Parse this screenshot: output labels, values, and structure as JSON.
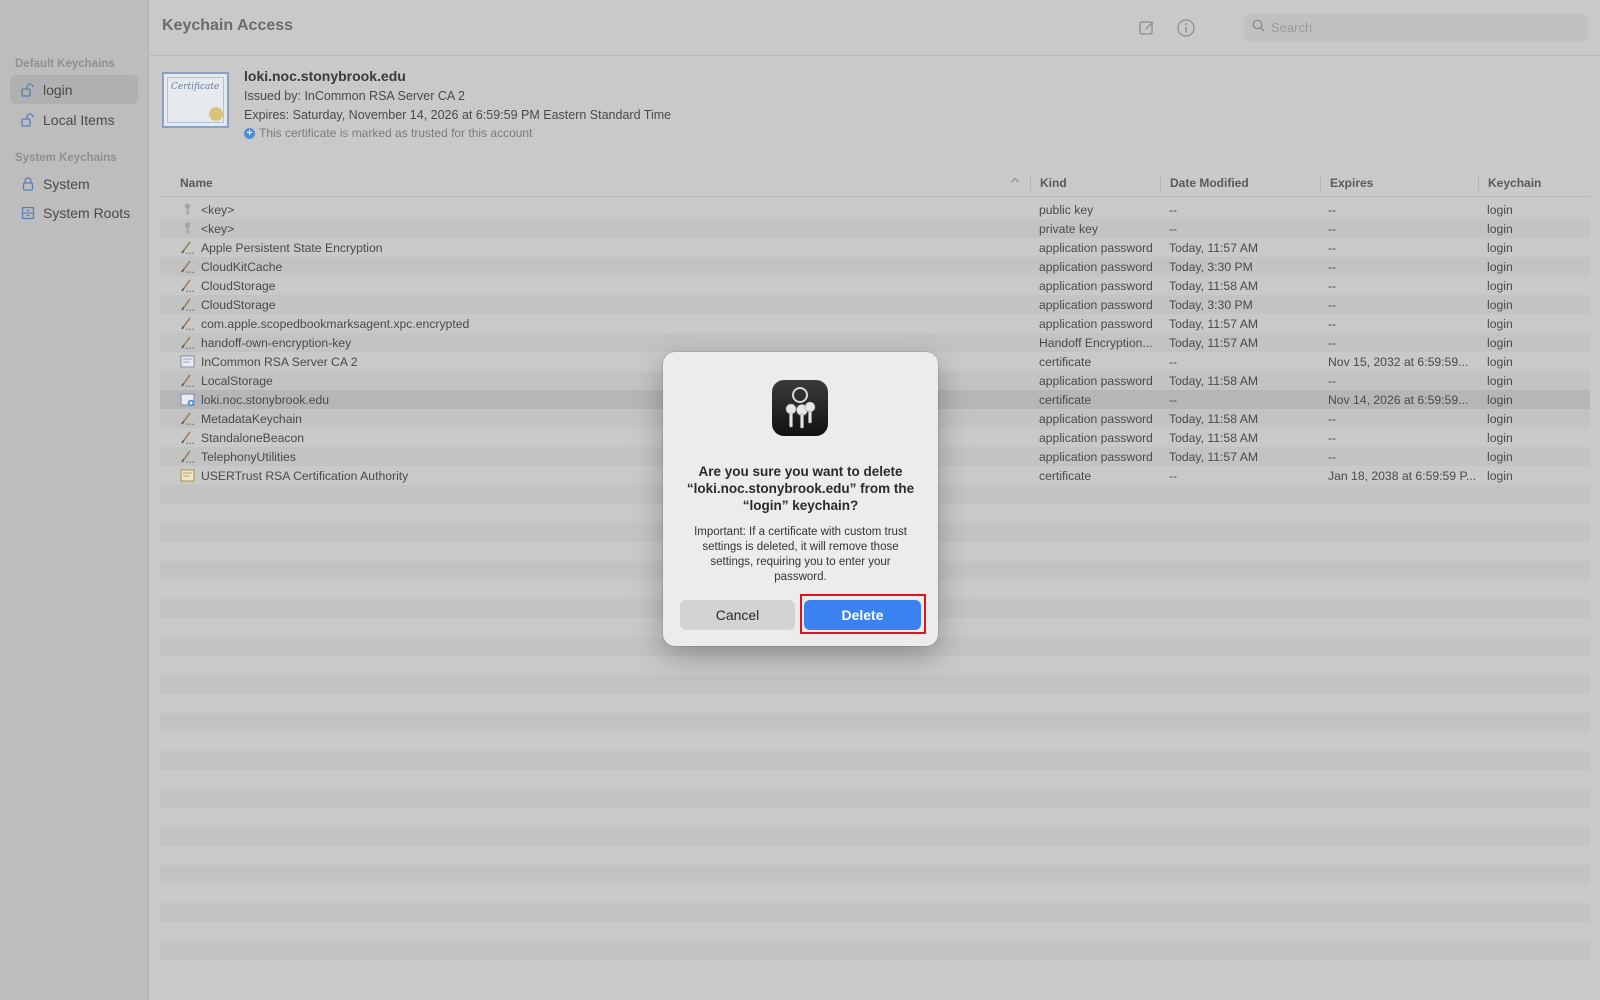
{
  "window": {
    "title": "Keychain Access"
  },
  "search": {
    "placeholder": "Search"
  },
  "sidebar": {
    "default_title": "Default Keychains",
    "system_title": "System Keychains",
    "items": [
      {
        "label": "login",
        "icon": "unlocked-padlock-icon",
        "selected": true
      },
      {
        "label": "Local Items",
        "icon": "unlocked-padlock-icon",
        "selected": false
      },
      {
        "label": "System",
        "icon": "locked-padlock-icon",
        "selected": false
      },
      {
        "label": "System Roots",
        "icon": "cabinet-icon",
        "selected": false
      }
    ]
  },
  "header": {
    "name": "loki.noc.stonybrook.edu",
    "issued_by": "Issued by: InCommon RSA Server CA 2",
    "expires": "Expires: Saturday, November 14, 2026 at 6:59:59 PM Eastern Standard Time",
    "trusted": "This certificate is marked as trusted for this account",
    "thumb_text": "Certificate"
  },
  "table": {
    "columns": {
      "name": "Name",
      "kind": "Kind",
      "date": "Date Modified",
      "expires": "Expires",
      "keychain": "Keychain"
    },
    "rows": [
      {
        "icon": "key",
        "name": "<key>",
        "kind": "public key",
        "date": "--",
        "expires": "--",
        "keychain": "login"
      },
      {
        "icon": "key",
        "name": "<key>",
        "kind": "private key",
        "date": "--",
        "expires": "--",
        "keychain": "login"
      },
      {
        "icon": "pen",
        "name": "Apple Persistent State Encryption",
        "kind": "application password",
        "date": "Today, 11:57 AM",
        "expires": "--",
        "keychain": "login"
      },
      {
        "icon": "pen",
        "name": "CloudKitCache",
        "kind": "application password",
        "date": "Today, 3:30 PM",
        "expires": "--",
        "keychain": "login"
      },
      {
        "icon": "pen",
        "name": "CloudStorage",
        "kind": "application password",
        "date": "Today, 11:58 AM",
        "expires": "--",
        "keychain": "login"
      },
      {
        "icon": "pen",
        "name": "CloudStorage",
        "kind": "application password",
        "date": "Today, 3:30 PM",
        "expires": "--",
        "keychain": "login"
      },
      {
        "icon": "pen",
        "name": "com.apple.scopedbookmarksagent.xpc.encrypted",
        "kind": "application password",
        "date": "Today, 11:57 AM",
        "expires": "--",
        "keychain": "login"
      },
      {
        "icon": "pen",
        "name": "handoff-own-encryption-key",
        "kind": "Handoff Encryption...",
        "date": "Today, 11:57 AM",
        "expires": "--",
        "keychain": "login"
      },
      {
        "icon": "cert",
        "name": "InCommon RSA Server CA 2",
        "kind": "certificate",
        "date": "--",
        "expires": "Nov 15, 2032 at 6:59:59...",
        "keychain": "login"
      },
      {
        "icon": "pen",
        "name": "LocalStorage",
        "kind": "application password",
        "date": "Today, 11:58 AM",
        "expires": "--",
        "keychain": "login"
      },
      {
        "icon": "cert-trusted",
        "name": "loki.noc.stonybrook.edu",
        "kind": "certificate",
        "date": "--",
        "expires": "Nov 14, 2026 at 6:59:59...",
        "keychain": "login",
        "selected": true
      },
      {
        "icon": "pen",
        "name": "MetadataKeychain",
        "kind": "application password",
        "date": "Today, 11:58 AM",
        "expires": "--",
        "keychain": "login"
      },
      {
        "icon": "pen",
        "name": "StandaloneBeacon",
        "kind": "application password",
        "date": "Today, 11:58 AM",
        "expires": "--",
        "keychain": "login"
      },
      {
        "icon": "pen",
        "name": "TelephonyUtilities",
        "kind": "application password",
        "date": "Today, 11:57 AM",
        "expires": "--",
        "keychain": "login"
      },
      {
        "icon": "cert-root",
        "name": "USERTrust RSA Certification Authority",
        "kind": "certificate",
        "date": "--",
        "expires": "Jan 18, 2038 at 6:59:59 P...",
        "keychain": "login"
      }
    ]
  },
  "dialog": {
    "heading": "Are you sure you want to delete “loki.noc.stonybrook.edu” from the “login” keychain?",
    "body": "Important: If a certificate with custom trust settings is deleted, it will remove those settings, requiring you to enter your password.",
    "cancel_label": "Cancel",
    "delete_label": "Delete"
  },
  "colors": {
    "accent": "#3b82f0",
    "highlight": "#e0141e"
  }
}
